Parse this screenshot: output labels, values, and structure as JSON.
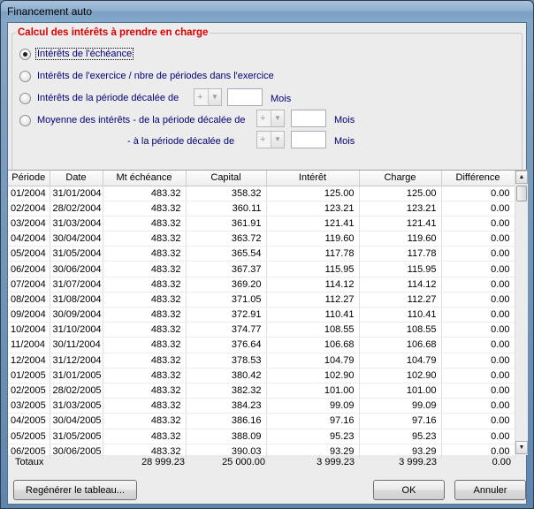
{
  "window": {
    "title": "Financement auto"
  },
  "group": {
    "title": "Calcul des intérêts à prendre en charge",
    "options": [
      {
        "label": "Intérêts de l'échéance",
        "checked": true
      },
      {
        "label": "Intérêts de l'exercice / nbre de périodes dans l'exercice",
        "checked": false
      },
      {
        "label": "Intérêts de la période décalée de",
        "checked": false
      },
      {
        "label": "Moyenne des intérêts  - de la période décalée de",
        "checked": false
      }
    ],
    "sub_label": "- à la période décalée de",
    "combo_sign": "+",
    "unit": "Mois"
  },
  "table": {
    "headers": [
      "Période",
      "Date",
      "Mt échéance",
      "Capital",
      "Intérêt",
      "Charge",
      "Différence"
    ],
    "rows": [
      [
        "01/2004",
        "31/01/2004",
        "483.32",
        "358.32",
        "125.00",
        "125.00",
        "0.00"
      ],
      [
        "02/2004",
        "28/02/2004",
        "483.32",
        "360.11",
        "123.21",
        "123.21",
        "0.00"
      ],
      [
        "03/2004",
        "31/03/2004",
        "483.32",
        "361.91",
        "121.41",
        "121.41",
        "0.00"
      ],
      [
        "04/2004",
        "30/04/2004",
        "483.32",
        "363.72",
        "119.60",
        "119.60",
        "0.00"
      ],
      [
        "05/2004",
        "31/05/2004",
        "483.32",
        "365.54",
        "117.78",
        "117.78",
        "0.00"
      ],
      [
        "06/2004",
        "30/06/2004",
        "483.32",
        "367.37",
        "115.95",
        "115.95",
        "0.00"
      ],
      [
        "07/2004",
        "31/07/2004",
        "483.32",
        "369.20",
        "114.12",
        "114.12",
        "0.00"
      ],
      [
        "08/2004",
        "31/08/2004",
        "483.32",
        "371.05",
        "112.27",
        "112.27",
        "0.00"
      ],
      [
        "09/2004",
        "30/09/2004",
        "483.32",
        "372.91",
        "110.41",
        "110.41",
        "0.00"
      ],
      [
        "10/2004",
        "31/10/2004",
        "483.32",
        "374.77",
        "108.55",
        "108.55",
        "0.00"
      ],
      [
        "11/2004",
        "30/11/2004",
        "483.32",
        "376.64",
        "106.68",
        "106.68",
        "0.00"
      ],
      [
        "12/2004",
        "31/12/2004",
        "483.32",
        "378.53",
        "104.79",
        "104.79",
        "0.00"
      ],
      [
        "01/2005",
        "31/01/2005",
        "483.32",
        "380.42",
        "102.90",
        "102.90",
        "0.00"
      ],
      [
        "02/2005",
        "28/02/2005",
        "483.32",
        "382.32",
        "101.00",
        "101.00",
        "0.00"
      ],
      [
        "03/2005",
        "31/03/2005",
        "483.32",
        "384.23",
        "99.09",
        "99.09",
        "0.00"
      ],
      [
        "04/2005",
        "30/04/2005",
        "483.32",
        "386.16",
        "97.16",
        "97.16",
        "0.00"
      ],
      [
        "05/2005",
        "31/05/2005",
        "483.32",
        "388.09",
        "95.23",
        "95.23",
        "0.00"
      ],
      [
        "06/2005",
        "30/06/2005",
        "483.32",
        "390.03",
        "93.29",
        "93.29",
        "0.00"
      ]
    ]
  },
  "totals": {
    "label": "Totaux",
    "mt_echeance": "28 999.23",
    "capital": "25 000.00",
    "interet": "3 999.23",
    "charge": "3 999.23",
    "difference": "0.00"
  },
  "buttons": {
    "regenerate": "Regénérer le tableau...",
    "ok": "OK",
    "cancel": "Annuler"
  }
}
